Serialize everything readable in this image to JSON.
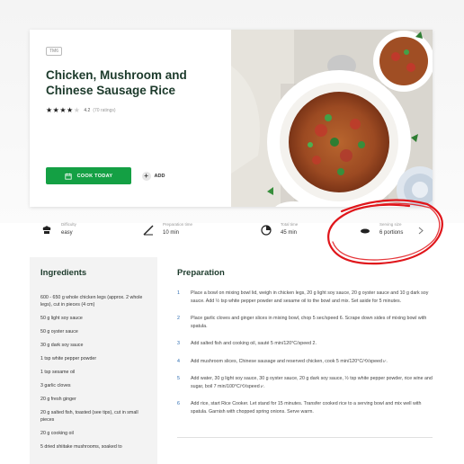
{
  "recipe": {
    "tag": "TM6",
    "title": "Chicken, Mushroom and Chinese Sausage Rice",
    "rating": {
      "value": "4.2",
      "count": "(70 ratings)",
      "stars": 4,
      "max_stars": 5
    }
  },
  "actions": {
    "cook_today": "COOK TODAY",
    "add": "ADD"
  },
  "info": [
    {
      "label": "Difficulty",
      "value": "easy",
      "icon": "chef-hat-icon"
    },
    {
      "label": "Preparation time",
      "value": "10 min",
      "icon": "knife-icon"
    },
    {
      "label": "Total time",
      "value": "45 min",
      "icon": "timer-icon"
    },
    {
      "label": "Serving size",
      "value": "6 portions",
      "icon": "portions-icon"
    }
  ],
  "ingredients": {
    "title": "Ingredients",
    "items": [
      "600 - 650 g whole chicken legs (approx. 2 whole legs), cut in pieces (4 cm)",
      "50 g light soy sauce",
      "50 g oyster sauce",
      "30 g dark soy sauce",
      "1 tsp white pepper powder",
      "1 tsp sesame oil",
      "3 garlic cloves",
      "20 g fresh ginger",
      "20 g salted fish, toasted (see tips), cut in small pieces",
      "20 g cooking oil",
      "5 dried shiitake mushrooms, soaked to"
    ]
  },
  "preparation": {
    "title": "Preparation",
    "steps": [
      {
        "num": "1",
        "text": "Place a bowl on mixing bowl lid, weigh in chicken legs, 20 g light soy sauce, 20 g oyster sauce and 10 g dark soy sauce. Add ½ tsp white pepper powder and sesame oil to the bowl and mix. Set aside for 5 minutes."
      },
      {
        "num": "2",
        "text": "Place garlic cloves and ginger slices in mixing bowl, chop 5 sec/speed 6. Scrape down sides of mixing bowl with spatula."
      },
      {
        "num": "3",
        "text": "Add salted fish and cooking oil, sauté 5 min/120°C/speed 2."
      },
      {
        "num": "4",
        "text": "Add mushroom slices, Chinese sausage and reserved chicken, cook 5 min/120°C/⟲/speed ⩗."
      },
      {
        "num": "5",
        "text": "Add water, 30 g light soy sauce, 30 g oyster sauce, 20 g dark soy sauce, ½ tsp white pepper powder, rice wine and sugar, boil 7 min/100°C/⟲/speed ⩗."
      },
      {
        "num": "6",
        "text": "Add rice, start Rice Cooker. Let stand for 15 minutes. Transfer cooked rice to a serving bowl and mix well with spatula. Garnish with chopped spring onions. Serve warm."
      }
    ]
  },
  "colors": {
    "brand_green": "#14a044",
    "title_green": "#1c3a2b",
    "annotation_red": "#e0161b",
    "step_blue": "#2a6ab0"
  }
}
